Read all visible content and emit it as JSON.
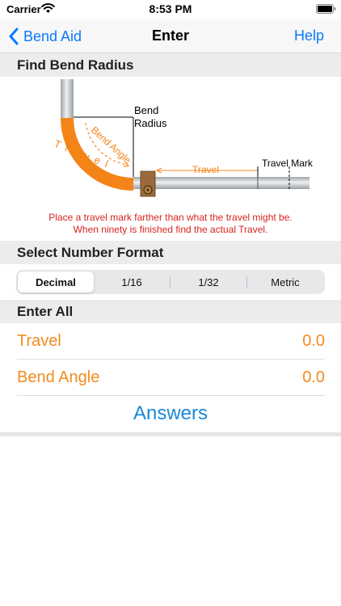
{
  "status_bar": {
    "carrier": "Carrier",
    "time": "8:53 PM"
  },
  "nav": {
    "back_label": "Bend Aid",
    "title": "Enter",
    "help_label": "Help"
  },
  "sections": {
    "find_bend_radius": "Find Bend Radius",
    "select_number_format": "Select Number Format",
    "enter_all": "Enter All"
  },
  "diagram": {
    "bend_radius_label_line1": "Bend",
    "bend_radius_label_line2": "Radius",
    "bend_angle_label": "Bend Angle",
    "travel_arc_label": "Travel",
    "travel_label": "Travel",
    "travel_mark_label": "Travel Mark"
  },
  "notes": {
    "line1": "Place a travel mark farther than what the travel might be.",
    "line2": "When ninety is finished find the actual Travel."
  },
  "number_format": {
    "options": [
      "Decimal",
      "1/16",
      "1/32",
      "Metric"
    ],
    "selected": "Decimal"
  },
  "inputs": {
    "travel": {
      "label": "Travel",
      "value": "0.0"
    },
    "bend_angle": {
      "label": "Bend Angle",
      "value": "0.0"
    }
  },
  "answers_label": "Answers",
  "colors": {
    "accent_blue": "#0a7aff",
    "orange": "#f08c1e",
    "note_red": "#d72222",
    "answers_blue": "#1a88d8"
  }
}
